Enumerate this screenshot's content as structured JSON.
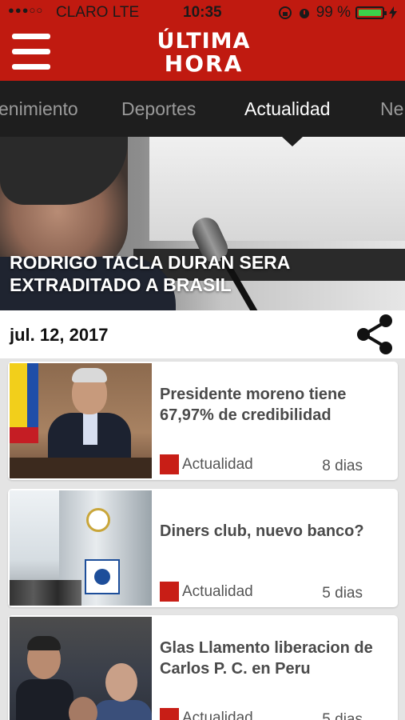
{
  "status_bar": {
    "signal": "●●●○○",
    "carrier": "CLARO  LTE",
    "time": "10:35",
    "battery_percent": "99 %",
    "battery_level": 0.99
  },
  "header": {
    "logo_line1": "ÚLTIMA",
    "logo_line2": "HORA"
  },
  "tabs": [
    {
      "label": "enimiento"
    },
    {
      "label": "Deportes"
    },
    {
      "label": "Actualidad"
    },
    {
      "label": "Ne"
    }
  ],
  "active_tab": "Actualidad",
  "hero": {
    "title": "RODRIGO TACLA DURAN SERA EXTRADITADO A BRASIL"
  },
  "date_bar": {
    "date": "jul. 12, 2017"
  },
  "articles": [
    {
      "headline": "Presidente moreno tiene 67,97% de credibilidad",
      "category": "Actualidad",
      "age": "8 dias"
    },
    {
      "headline": "Diners club, nuevo banco?",
      "category": "Actualidad",
      "age": "5 dias"
    },
    {
      "headline": "Glas Llamento liberacion de Carlos P. C. en Peru",
      "category": "Actualidad",
      "age": "5 dias"
    }
  ],
  "colors": {
    "brand_red": "#c01a10",
    "tab_bar": "#1e1e1e",
    "category_marker": "#c81e16"
  }
}
